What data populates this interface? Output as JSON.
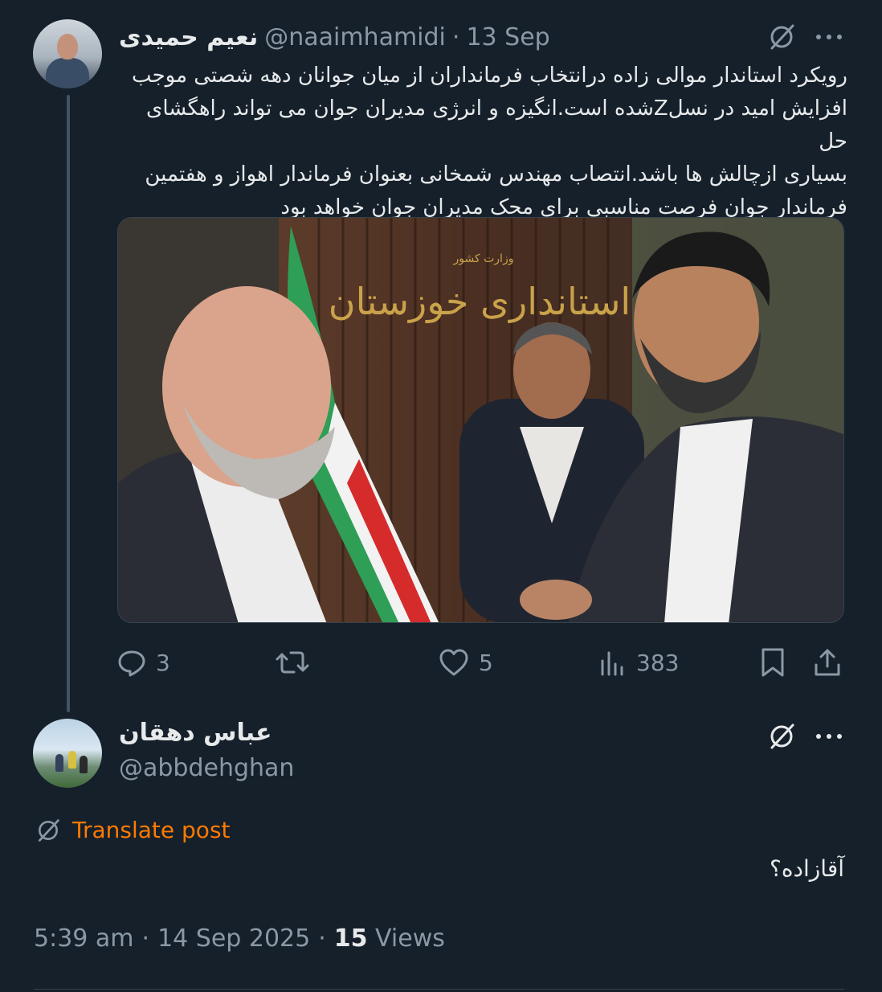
{
  "tweet": {
    "author_name": "نعیم حمیدی",
    "handle": "@naaimhamidi",
    "separator": "·",
    "date": "13 Sep",
    "text_lines": [
      "رویکرد استاندار موالی زاده درانتخاب فرمانداران از میان جوانان دهه شصتی موجب",
      "افزایش امید در نسلZشده است.انگیزه و انرژی مدیران جوان می تواند راهگشای حل",
      "بسیاری ازچالش ها باشد.انتصاب مهندس شمخانی بعنوان فرماندار اهواز و هفتمین",
      "فرماندار جوان فرصت مناسبی برای محک مدیران جوان خواهد بود"
    ],
    "image_sign": {
      "small": "وزارت کشور",
      "large": "استانداری خوزستان"
    },
    "actions": {
      "replies": "3",
      "retweets": "",
      "likes": "5",
      "views": "383"
    }
  },
  "reply": {
    "author_name": "عباس دهقان",
    "handle": "@abbdehghan",
    "translate_label": "Translate post",
    "text": "آقازاده؟",
    "time": "5:39 am",
    "separator": "·",
    "date": "14 Sep 2025",
    "views_count": "15",
    "views_label": "Views"
  },
  "colors": {
    "background": "#15202b",
    "text": "#e7e9ea",
    "muted": "#8b98a5",
    "translate": "#ff7a00"
  }
}
